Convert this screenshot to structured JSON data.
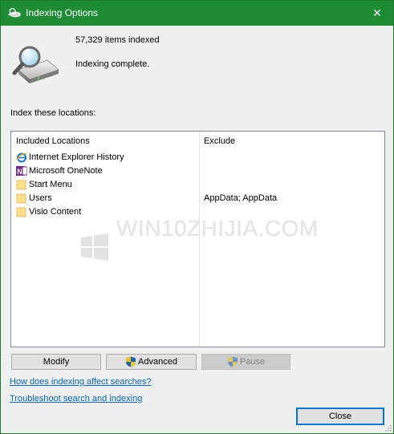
{
  "window": {
    "title": "Indexing Options",
    "close_glyph": "✕",
    "titlebar_color": "#1e8c34"
  },
  "status": {
    "items_indexed": "57,329 items indexed",
    "message": "Indexing complete."
  },
  "locations": {
    "label": "Index these locations:",
    "columns": {
      "included": "Included Locations",
      "exclude": "Exclude"
    },
    "rows": [
      {
        "name": "Internet Explorer History",
        "exclude": "",
        "icon": "ie-icon"
      },
      {
        "name": "Microsoft OneNote",
        "exclude": "",
        "icon": "onenote-icon"
      },
      {
        "name": "Start Menu",
        "exclude": "",
        "icon": "folder-icon"
      },
      {
        "name": "Users",
        "exclude": "AppData; AppData",
        "icon": "folder-icon"
      },
      {
        "name": "Visio Content",
        "exclude": "",
        "icon": "folder-icon"
      }
    ]
  },
  "watermark": {
    "text": "WIN10ZHIJIA.COM"
  },
  "buttons": {
    "modify": "Modify",
    "advanced": "Advanced",
    "pause": "Pause",
    "close": "Close"
  },
  "links": {
    "how_indexing": "How does indexing affect searches?",
    "troubleshoot": "Troubleshoot search and indexing"
  },
  "colors": {
    "link": "#0066cc",
    "focus_border": "#0078d7",
    "ie_blue": "#1a75d2",
    "onenote_purple": "#7a2a8c",
    "folder_yellow": "#ffe08a"
  }
}
